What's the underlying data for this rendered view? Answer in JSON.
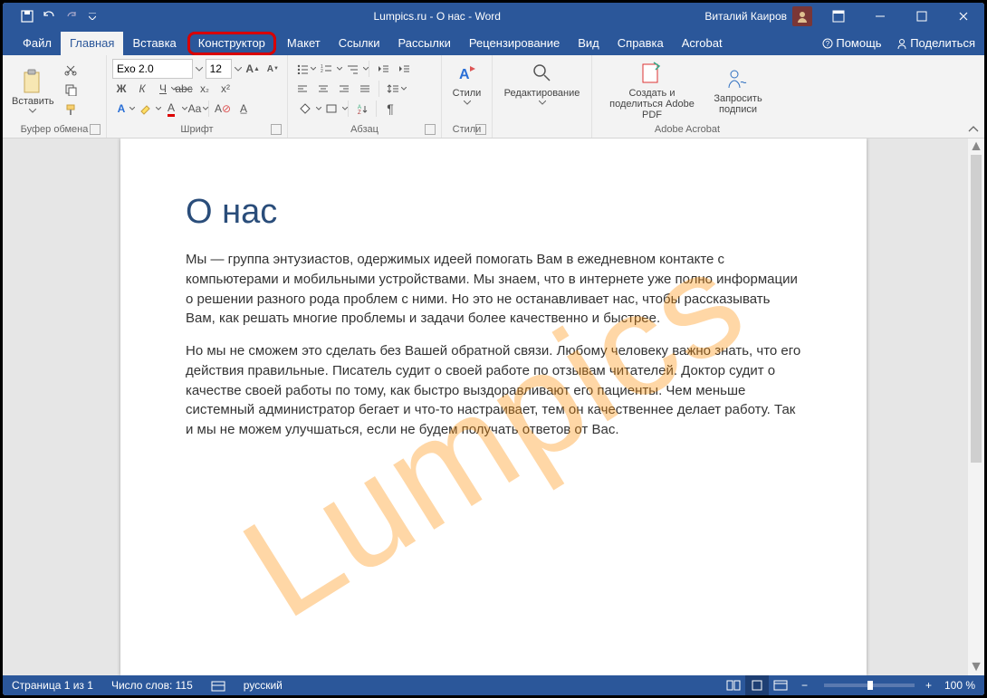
{
  "title": "Lumpics.ru - О нас  -  Word",
  "user": "Виталий Каиров",
  "tabs": {
    "file": "Файл",
    "home": "Главная",
    "insert": "Вставка",
    "design": "Конструктор",
    "layout": "Макет",
    "references": "Ссылки",
    "mailings": "Рассылки",
    "review": "Рецензирование",
    "view": "Вид",
    "help": "Справка",
    "acrobat": "Acrobat",
    "tell_me": "Помощь",
    "share": "Поделиться"
  },
  "ribbon": {
    "clipboard": {
      "paste": "Вставить",
      "label": "Буфер обмена"
    },
    "font": {
      "name": "Exo 2.0",
      "size": "12",
      "label": "Шрифт"
    },
    "paragraph": {
      "label": "Абзац"
    },
    "styles": {
      "btn": "Стили",
      "label": "Стили"
    },
    "editing": {
      "btn": "Редактирование"
    },
    "acrobat": {
      "create": "Создать и поделиться Adobe PDF",
      "sign": "Запросить подписи",
      "label": "Adobe Acrobat"
    }
  },
  "doc": {
    "heading": "О нас",
    "p1": "Мы — группа энтузиастов, одержимых идеей помогать Вам в ежедневном контакте с компьютерами и мобильными устройствами. Мы знаем, что в интернете уже полно информации о решении разного рода проблем с ними. Но это не останавливает нас, чтобы рассказывать Вам, как решать многие проблемы и задачи более качественно и быстрее.",
    "p2": "Но мы не сможем это сделать без Вашей обратной связи. Любому человеку важно знать, что его действия правильные. Писатель судит о своей работе по отзывам читателей. Доктор судит о качестве своей работы по тому, как быстро выздоравливают его пациенты. Чем меньше системный администратор бегает и что-то настраивает, тем он качественнее делает работу. Так и мы не можем улучшаться, если не будем получать ответов от Вас."
  },
  "status": {
    "page": "Страница 1 из 1",
    "words": "Число слов: 115",
    "lang": "русский",
    "zoom": "100 %"
  },
  "watermark": "Lumpics"
}
